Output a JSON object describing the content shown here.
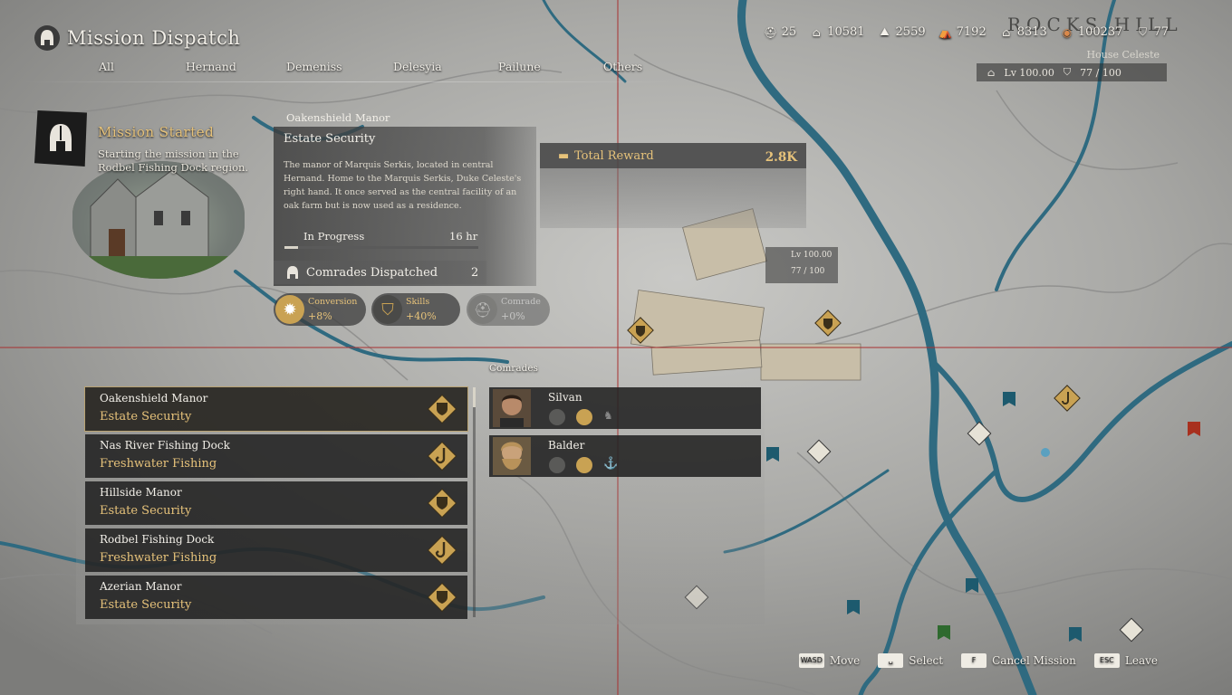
{
  "header": {
    "title": "Mission Dispatch"
  },
  "tabs": [
    {
      "label": "All"
    },
    {
      "label": "Hernand"
    },
    {
      "label": "Demeniss"
    },
    {
      "label": "Delesyia"
    },
    {
      "label": "Pailune"
    },
    {
      "label": "Others"
    }
  ],
  "resources": [
    {
      "icon": "helmet-icon",
      "value": "25"
    },
    {
      "icon": "house-icon",
      "value": "10581"
    },
    {
      "icon": "fields-icon",
      "value": "2559"
    },
    {
      "icon": "tent-icon",
      "value": "7192"
    },
    {
      "icon": "barracks-icon",
      "value": "8313"
    },
    {
      "icon": "coin-icon",
      "value": "100237"
    },
    {
      "icon": "crest-icon",
      "value": "77"
    }
  ],
  "house": {
    "name": "House Celeste",
    "level": "Lv 100.00",
    "crest": "77 / 100"
  },
  "mission_started": {
    "title": "Mission Started",
    "desc": "Starting the mission in the Rodbel Fishing Dock region."
  },
  "detail": {
    "location": "Oakenshield Manor",
    "type": "Estate Security",
    "description": "The manor of Marquis Serkis, located in central Hernand. Home to the Marquis Serkis, Duke Celeste's right hand. It once served as the central facility of an oak farm but is now used as a residence.",
    "progress_label": "In Progress",
    "progress_time": "16 hr",
    "progress": 0.07,
    "dispatched_label": "Comrades Dispatched",
    "dispatched_count": "2"
  },
  "reward": {
    "label": "Total Reward",
    "value": "2.8K"
  },
  "bonuses": [
    {
      "name": "Conversion",
      "value": "+8%"
    },
    {
      "name": "Skills",
      "value": "+40%"
    },
    {
      "name": "Comrade",
      "value": "+0%"
    }
  ],
  "comrades_label": "Comrades",
  "missions": [
    {
      "name": "Oakenshield Manor",
      "type": "Estate Security",
      "icon": "shield-badge-icon"
    },
    {
      "name": "Nas River Fishing Dock",
      "type": "Freshwater Fishing",
      "icon": "hook-badge-icon"
    },
    {
      "name": "Hillside Manor",
      "type": "Estate Security",
      "icon": "shield-badge-icon"
    },
    {
      "name": "Rodbel Fishing Dock",
      "type": "Freshwater Fishing",
      "icon": "hook-badge-icon"
    },
    {
      "name": "Azerian Manor",
      "type": "Estate Security",
      "icon": "shield-badge-icon"
    }
  ],
  "comrades": [
    {
      "name": "Silvan"
    },
    {
      "name": "Balder"
    }
  ],
  "map": {
    "label": "ROCKS HILL",
    "level": "Lv 100.00",
    "crest": "77 / 100"
  },
  "footer": [
    {
      "key": "WASD",
      "label": "Move"
    },
    {
      "key": "␣",
      "label": "Select"
    },
    {
      "key": "F",
      "label": "Cancel Mission"
    },
    {
      "key": "ESC",
      "label": "Leave"
    }
  ],
  "colors": {
    "accent": "#e6c27a",
    "river": "#2f6a80",
    "panel": "#222222"
  }
}
